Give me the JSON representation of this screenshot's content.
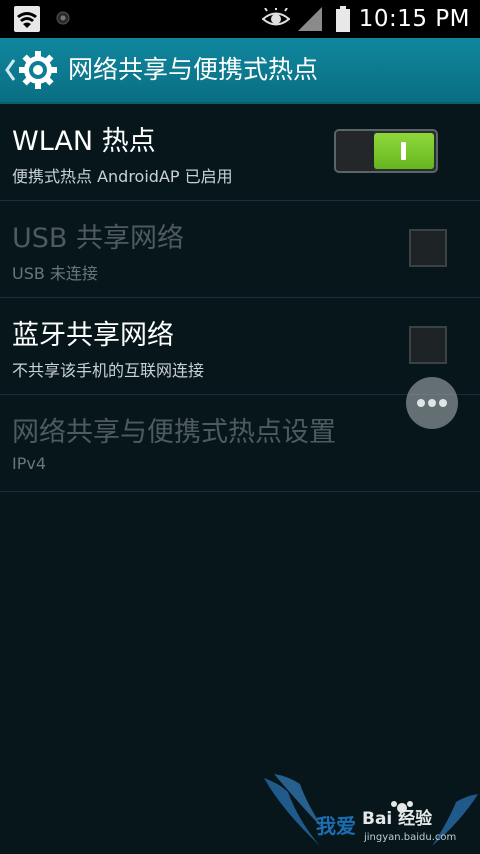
{
  "status_bar": {
    "time": "10:15 PM",
    "icons": [
      "wifi-icon",
      "notification-dot-icon",
      "eye-icon",
      "signal-icon",
      "battery-icon"
    ]
  },
  "action_bar": {
    "title": "网络共享与便携式热点",
    "icon": "settings-gear-icon",
    "accent_color": "#0d7f95"
  },
  "settings": {
    "items": [
      {
        "title": "WLAN 热点",
        "subtitle": "便携式热点 AndroidAP 已启用",
        "control": "toggle",
        "enabled": true,
        "on": true
      },
      {
        "title": "USB 共享网络",
        "subtitle": "USB 未连接",
        "control": "checkbox",
        "enabled": false,
        "checked": false
      },
      {
        "title": "蓝牙共享网络",
        "subtitle": "不共享该手机的互联网连接",
        "control": "checkbox",
        "enabled": true,
        "checked": false
      },
      {
        "title": "网络共享与便携式热点设置",
        "subtitle": "IPv4",
        "control": "none",
        "enabled": false
      }
    ]
  },
  "floating_button": {
    "icon": "more-dots-icon"
  },
  "watermark": {
    "line1": "我爱",
    "line2": "Bai 经验",
    "line3": "jingyan.baidu.com"
  }
}
